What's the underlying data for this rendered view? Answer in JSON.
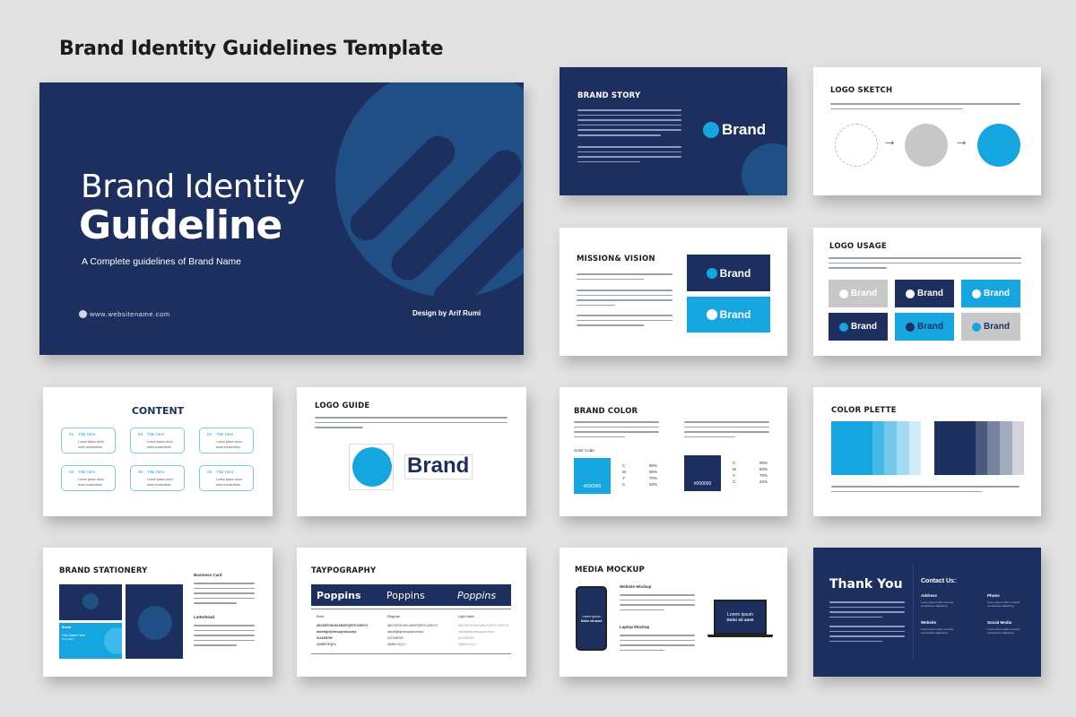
{
  "page": {
    "title": "Brand Identity Guidelines Template"
  },
  "colors": {
    "navy": "#1c2f5e",
    "blue": "#16a6df",
    "mid_blue": "#1f4f85",
    "grey": "#c8c8c8",
    "bg": "#e1e1e1"
  },
  "cover": {
    "title_line1": "Brand Identity",
    "title_line2": "Guideline",
    "subtitle": "A Complete guidelines of Brand Name",
    "website": "www.websitename.com",
    "website_icon": "globe-icon",
    "credit": "Design by Arif Rumi"
  },
  "brand_story": {
    "title": "BRAND STORY",
    "logo_text": "Brand"
  },
  "logo_sketch": {
    "title": "LOGO SKETCH",
    "arrow": "→"
  },
  "mission": {
    "title": "MISSION& VISION",
    "logo_text": "Brand"
  },
  "logo_usage": {
    "title": "LOGO USAGE",
    "logo_text": "Brand",
    "variants": [
      {
        "bg": "#c8c8c8",
        "fg": "#ffffff"
      },
      {
        "bg": "#1c2f5e",
        "fg": "#ffffff"
      },
      {
        "bg": "#16a6df",
        "fg": "#ffffff"
      },
      {
        "bg": "#1c2f5e",
        "fg": "#ffffff",
        "mark": "#16a6df"
      },
      {
        "bg": "#16a6df",
        "fg": "#1c2f5e"
      },
      {
        "bg": "#c8c8c8",
        "fg": "#1c2f5e",
        "mark": "#16a6df"
      }
    ]
  },
  "content": {
    "title": "CONTENT",
    "items": [
      {
        "num": "01",
        "label": "Tilte Here",
        "desc1": "Lorem ipsum dolor",
        "desc2": "amet consectetur"
      },
      {
        "num": "02",
        "label": "Tilte Here",
        "desc1": "Lorem ipsum dolor",
        "desc2": "amet consectetur"
      },
      {
        "num": "03",
        "label": "Tilte Here",
        "desc1": "Lorem ipsum dolor",
        "desc2": "amet consectetur"
      },
      {
        "num": "04",
        "label": "Tilte Here",
        "desc1": "Lorem ipsum dolor",
        "desc2": "amet consectetur"
      },
      {
        "num": "05",
        "label": "Tilte Here",
        "desc1": "Lorem ipsum dolor",
        "desc2": "amet consectetur"
      },
      {
        "num": "06",
        "label": "Tilte Here",
        "desc1": "Lorem ipsum dolor",
        "desc2": "amet consectetur"
      }
    ]
  },
  "logo_guide": {
    "title": "LOGO GUIDE",
    "logo_text": "Brand"
  },
  "brand_color": {
    "title": "BRAND COLOR",
    "color_code_label": "Color Code",
    "swatches": [
      {
        "hex_label": "#000000",
        "color": "#16a6df",
        "cmyk": [
          [
            "C",
            "90%"
          ],
          [
            "M",
            "80%"
          ],
          [
            "Y",
            "70%"
          ],
          [
            "C",
            "20%"
          ]
        ]
      },
      {
        "hex_label": "#000000",
        "color": "#1c2f5e",
        "cmyk": [
          [
            "C",
            "90%"
          ],
          [
            "M",
            "80%"
          ],
          [
            "Y",
            "70%"
          ],
          [
            "C",
            "20%"
          ]
        ]
      }
    ]
  },
  "color_palette": {
    "title": "COLOR PLETTE",
    "blue_shades": [
      "#16a6df",
      "#45b8e6",
      "#73c9ec",
      "#a2daf2",
      "#d0ecf8"
    ],
    "navy_shades": [
      "#1c2f5e",
      "#4a5a7e",
      "#77829e",
      "#a4acbf",
      "#d2d5df"
    ]
  },
  "stationery": {
    "title": "BRAND STATIONERY",
    "business_card_label": "Business Card",
    "letterhead_label": "Letterhead",
    "card_brand": "Brand",
    "card_name": "Your Name Here",
    "card_role": "Designation"
  },
  "typography": {
    "title": "TAYPOGRAPHY",
    "fonts": [
      "Poppins",
      "Poppins",
      "Poppins"
    ],
    "columns": [
      {
        "style": "Bold",
        "lines": [
          "ABCDEFGHIJKLMNOPQRSTUVWXYZ",
          "abcdefghijklmnopqrstuvwxyz",
          "0123456789",
          "!@#$%^&*()+="
        ]
      },
      {
        "style": "Regular",
        "lines": [
          "ABCDEFGHIJKLMNOPQRSTUVWXYZ",
          "abcdefghijklmnopqrstuvwxyz",
          "0123456789",
          "!@#$%^&*()+="
        ]
      },
      {
        "style": "Light Italic",
        "lines": [
          "ABCDEFGHIJKLMNOPQRSTUVWXYZ",
          "abcdefghijklmnopqrstuvwxyz",
          "0123456789",
          "!@#$%^&*()+="
        ]
      }
    ]
  },
  "media": {
    "title": "MEDIA MOCKUP",
    "website_label": "Website Mockup",
    "laptop_label": "Laptop Mockup",
    "screen_line1": "Lorem ipsum",
    "screen_line2": "Dolor sit amet"
  },
  "thanks": {
    "title": "Thank You",
    "contact_title": "Contact Us:",
    "fields": [
      {
        "label": "Address",
        "l1": "Lorem ipsum dolor sit amet",
        "l2": "consectetur adipiscing"
      },
      {
        "label": "Phone",
        "l1": "Lorem ipsum dolor sit amet",
        "l2": "consectetur adipiscing"
      },
      {
        "label": "Website",
        "l1": "Lorem ipsum dolor sit amet",
        "l2": "consectetur adipiscing"
      },
      {
        "label": "Social Media",
        "l1": "Lorem ipsum dolor sit amet",
        "l2": "consectetur adipiscing"
      }
    ]
  }
}
